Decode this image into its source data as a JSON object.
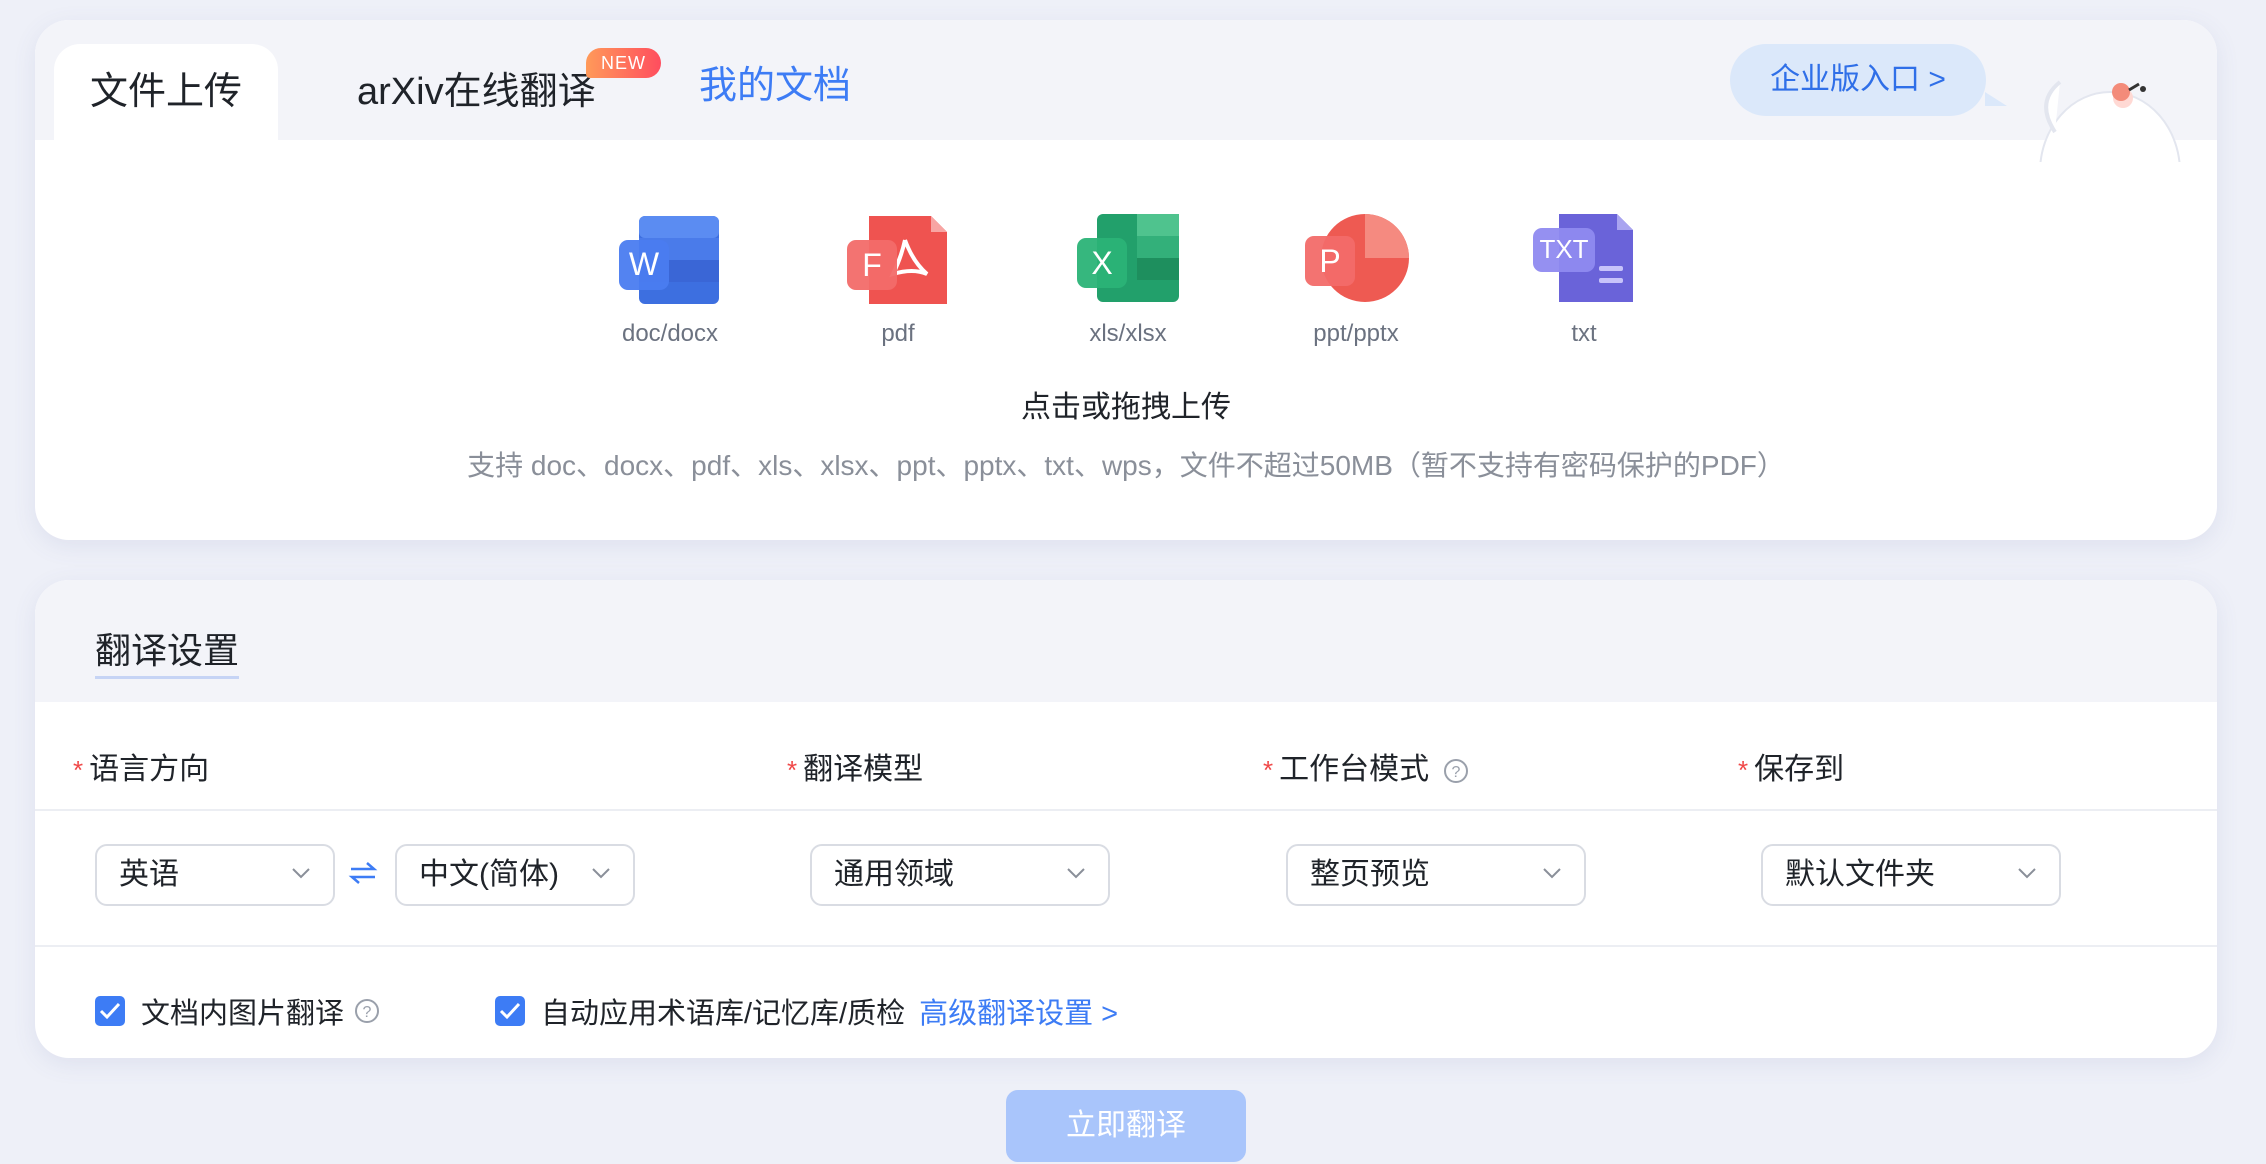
{
  "tabs": {
    "upload": "文件上传",
    "arxiv": "arXiv在线翻译",
    "arxiv_badge": "NEW",
    "mydocs": "我的文档"
  },
  "enterprise": {
    "label": "企业版入口 >"
  },
  "file_types": [
    {
      "label": "doc/docx",
      "letter": "W",
      "color": "#3d6fe0",
      "icon": "word-icon"
    },
    {
      "label": "pdf",
      "letter": "F",
      "color": "#ef5350",
      "icon": "pdf-icon"
    },
    {
      "label": "xls/xlsx",
      "letter": "X",
      "color": "#22a06b",
      "icon": "excel-icon"
    },
    {
      "label": "ppt/pptx",
      "letter": "P",
      "color": "#f0605a",
      "icon": "powerpoint-icon"
    },
    {
      "label": "txt",
      "letter": "TXT",
      "color": "#6a63d9",
      "icon": "txt-icon"
    }
  ],
  "upload": {
    "title": "点击或拖拽上传",
    "hint": "支持 doc、docx、pdf、xls、xlsx、ppt、pptx、txt、wps，文件不超过50MB（暂不支持有密码保护的PDF）"
  },
  "settings": {
    "title": "翻译设置",
    "required_mark": "*",
    "labels": {
      "language": "语言方向",
      "model": "翻译模型",
      "mode": "工作台模式",
      "save": "保存到"
    },
    "values": {
      "source_lang": "英语",
      "target_lang": "中文(简体)",
      "model": "通用领域",
      "mode": "整页预览",
      "save": "默认文件夹"
    },
    "options": {
      "image_translate": "文档内图片翻译",
      "auto_apply": "自动应用术语库/记忆库/质检",
      "image_translate_checked": true,
      "auto_apply_checked": true
    },
    "advanced_link": "高级翻译设置 >"
  },
  "action": {
    "translate": "立即翻译"
  },
  "colors": {
    "accent": "#3d7cf5",
    "required": "#f04848",
    "button_disabled": "#a9c5fb"
  }
}
